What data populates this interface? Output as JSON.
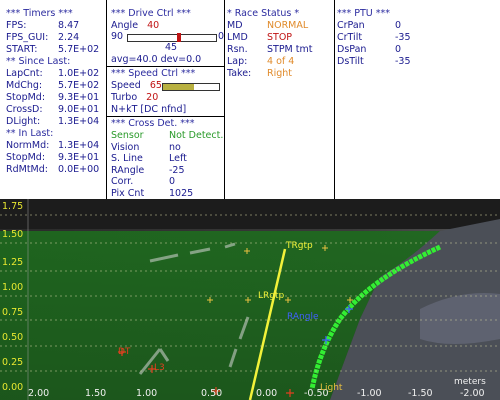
{
  "timers": {
    "header": "*** Timers ***",
    "rows": [
      {
        "label": "FPS:",
        "value": "8.47"
      },
      {
        "label": "FPS_GUI:",
        "value": "2.24"
      },
      {
        "label": "START:",
        "value": "5.7E+02"
      }
    ],
    "since_header": "** Since Last:",
    "since_rows": [
      {
        "label": "LapCnt:",
        "value": "1.0E+02"
      },
      {
        "label": "MdChg:",
        "value": "5.7E+02"
      },
      {
        "label": "StopMd:",
        "value": "9.3E+01"
      },
      {
        "label": "CrossD:",
        "value": "9.0E+01"
      },
      {
        "label": "DLight:",
        "value": "1.3E+04"
      }
    ],
    "inlast_header": "** In Last:",
    "inlast_rows": [
      {
        "label": "NormMd:",
        "value": "1.3E+04"
      },
      {
        "label": "StopMd:",
        "value": "9.3E+01"
      },
      {
        "label": "RdMtMd:",
        "value": "0.0E+00"
      }
    ]
  },
  "drive": {
    "header": "***  Drive Ctrl  ***",
    "angle_label": "Angle",
    "angle_value": "40",
    "slider_min": "90",
    "slider_max": "0",
    "slider_mid": "45",
    "slider_fraction": 0.58,
    "avg_text": "avg=40.0  dev=0.0",
    "speed_header": "***  Speed Ctrl  ***",
    "speed_label": "Speed",
    "speed_value": "65",
    "speed_fraction": 0.55,
    "turbo_label": "Turbo",
    "turbo_value": "20",
    "nkt_text": "N+kT [DC nfnd]",
    "cross_header": "*** Cross Det. ***",
    "cross_rows": [
      {
        "label": "Sensor",
        "value": "Not Detect."
      },
      {
        "label": "Vision",
        "value": "no"
      },
      {
        "label": "S. Line",
        "value": "Left"
      },
      {
        "label": "RAngle",
        "value": "-25"
      },
      {
        "label": "Corr.",
        "value": "0"
      },
      {
        "label": "Pix Cnt",
        "value": "1025"
      }
    ]
  },
  "race": {
    "header": "* Race Status *",
    "rows": [
      {
        "label": "MD",
        "value": "NORMAL"
      },
      {
        "label": "LMD",
        "value": "STOP"
      },
      {
        "label": "Rsn.",
        "value": "STPM tmt"
      },
      {
        "label": "Lap:",
        "value": "4 of 4"
      },
      {
        "label": "Take:",
        "value": "Right"
      }
    ]
  },
  "ptu": {
    "header": "*** PTU ***",
    "rows": [
      {
        "label": "CrPan",
        "value": "0"
      },
      {
        "label": "CrTilt",
        "value": "-35"
      },
      {
        "label": "DsPan",
        "value": "0"
      },
      {
        "label": "DsTilt",
        "value": "-35"
      }
    ]
  },
  "camera": {
    "y_labels": [
      "1.75",
      "1.50",
      "1.25",
      "1.00",
      "0.75",
      "0.50",
      "0.25",
      "0.00"
    ],
    "x_labels": [
      "2.00",
      "1.50",
      "1.00",
      "0.50",
      "0.00",
      "-0.50",
      "-1.00",
      "-1.50",
      "-2.00"
    ],
    "x_unit": "meters",
    "markers": {
      "tr": "TRgtp",
      "lr": "LRgtp",
      "rangle": "RAngle",
      "lt": "DT",
      "l3": "L3",
      "light": "Light"
    }
  },
  "colors": {
    "label": "#1b1b8f",
    "red_value": "#c01414",
    "orange_value": "#e08a2a",
    "sensor_green": "#2a9a2a",
    "axis_yellow": "#e8e830",
    "track_green": "#33ee33"
  }
}
